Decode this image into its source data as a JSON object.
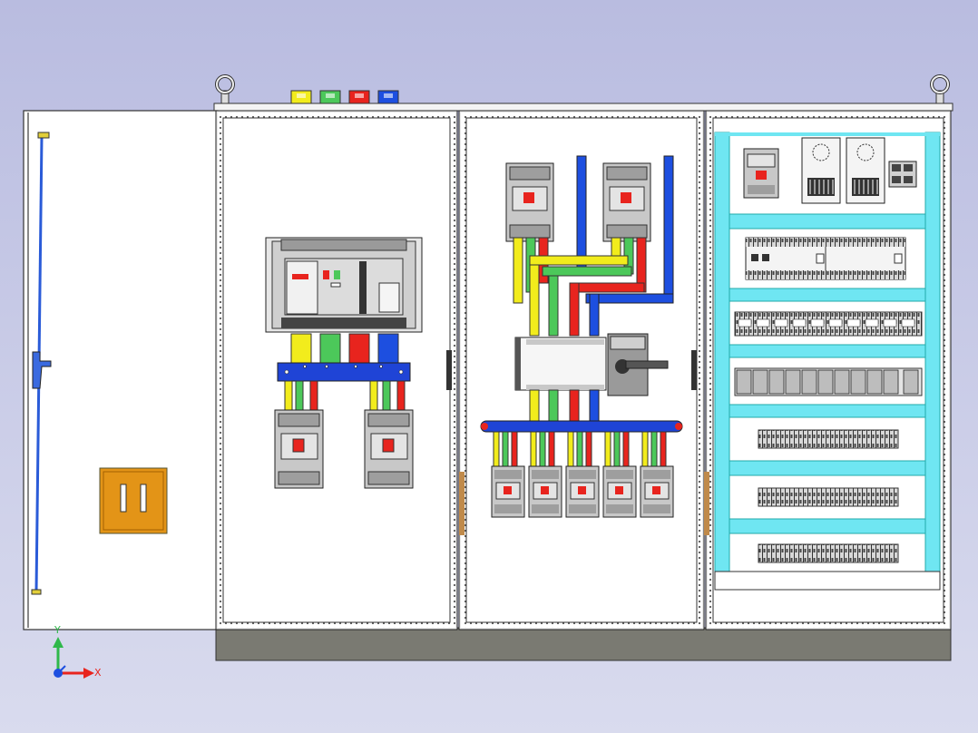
{
  "viewport": {
    "background_top": "#b9bce0",
    "background_bottom": "#d9dbee"
  },
  "triad": {
    "x_label": "X",
    "y_label": "Y"
  },
  "colors": {
    "phase_yellow": "#f2ec1c",
    "phase_green": "#4cc85a",
    "phase_red": "#e8241e",
    "neutral_blue": "#1d4fe0",
    "bus_blue": "#1f44d6",
    "cyan_rail": "#6fe6f2",
    "plinth": "#7a7a72",
    "door_white": "#ffffff",
    "terminal_box": "#e39417",
    "breaker_grey": "#c8c8c8"
  },
  "components": {
    "phase_markers": [
      "yellow-marker",
      "green-marker",
      "red-marker",
      "blue-marker"
    ],
    "feeder_breaker_count": 5,
    "terminal_strip_rows": 3,
    "din_rail_rows": 8
  }
}
